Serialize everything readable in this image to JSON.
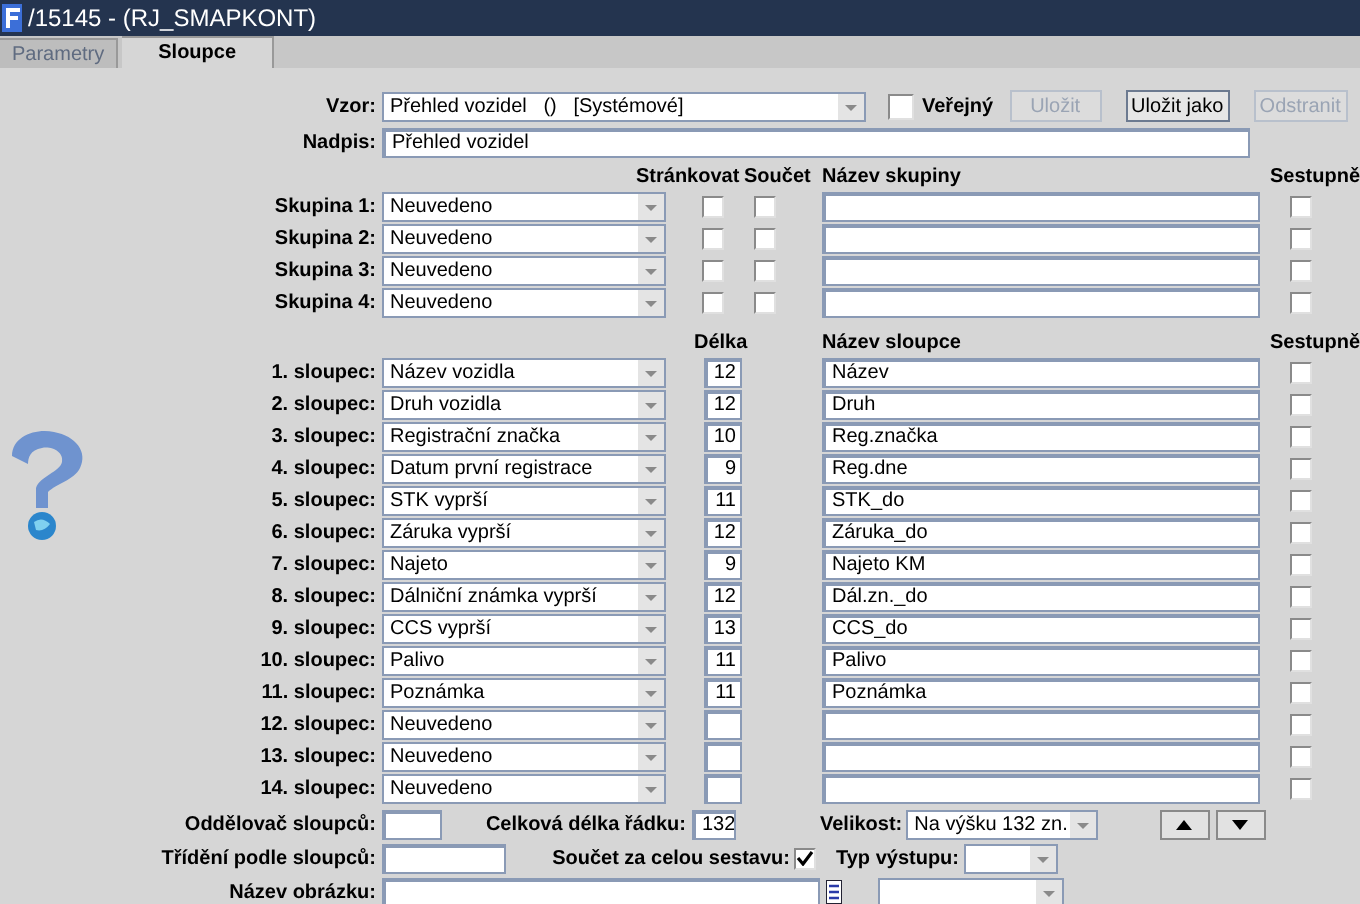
{
  "window": {
    "title": "/15145 - (RJ_SMAPKONT)"
  },
  "tabs": [
    {
      "label": "Parametry",
      "selected": false,
      "disabled": true
    },
    {
      "label": "Sloupce",
      "selected": true,
      "disabled": false
    }
  ],
  "template": {
    "label": "Vzor:",
    "value": "Přehled vozidel   ()   [Systémové]",
    "public": {
      "label": "Veřejný",
      "checked": false
    }
  },
  "buttons": [
    {
      "label": "Uložit",
      "disabled": true
    },
    {
      "label": "Uložit jako",
      "disabled": false
    },
    {
      "label": "Odstranit",
      "disabled": true
    }
  ],
  "heading": {
    "label": "Nadpis:",
    "value": "Přehled vozidel"
  },
  "groups": {
    "headers": [
      "Stránkovat",
      "Součet",
      "Název skupiny",
      "Sestupně"
    ],
    "rows": [
      {
        "label": "Skupina 1:",
        "value": "Neuvedeno",
        "paging": false,
        "sum": false,
        "descending": false
      },
      {
        "label": "Skupina 2:",
        "value": "Neuvedeno",
        "paging": false,
        "sum": false,
        "descending": false
      },
      {
        "label": "Skupina 3:",
        "value": "Neuvedeno",
        "paging": false,
        "sum": false,
        "descending": false
      },
      {
        "label": "Skupina 4:",
        "value": "Neuvedeno",
        "paging": false,
        "sum": false,
        "descending": false
      }
    ]
  },
  "columns": {
    "headers": [
      "Délka",
      "Název sloupce",
      "Sestupně"
    ],
    "rows": [
      {
        "label": "1. sloupec:",
        "value": "Název vozidla",
        "length": "12",
        "name": "Název",
        "descending": false
      },
      {
        "label": "2. sloupec:",
        "value": "Druh vozidla",
        "length": "12",
        "name": "Druh",
        "descending": false
      },
      {
        "label": "3. sloupec:",
        "value": "Registrační značka",
        "length": "10",
        "name": "Reg.značka",
        "descending": false
      },
      {
        "label": "4. sloupec:",
        "value": "Datum první registrace",
        "length": "9",
        "name": "Reg.dne",
        "descending": false
      },
      {
        "label": "5. sloupec:",
        "value": "STK vyprší",
        "length": "11",
        "name": "STK_do",
        "descending": false
      },
      {
        "label": "6. sloupec:",
        "value": "Záruka vyprší",
        "length": "12",
        "name": "Záruka_do",
        "descending": false
      },
      {
        "label": "7. sloupec:",
        "value": "Najeto",
        "length": "9",
        "name": "Najeto KM",
        "descending": false
      },
      {
        "label": "8. sloupec:",
        "value": "Dálniční známka vyprší",
        "length": "12",
        "name": "Dál.zn._do",
        "descending": false
      },
      {
        "label": "9. sloupec:",
        "value": "CCS vyprší",
        "length": "13",
        "name": "CCS_do",
        "descending": false
      },
      {
        "label": "10. sloupec:",
        "value": "Palivo",
        "length": "11",
        "name": "Palivo",
        "descending": false
      },
      {
        "label": "11. sloupec:",
        "value": "Poznámka",
        "length": "11",
        "name": "Poznámka",
        "descending": false
      },
      {
        "label": "12. sloupec:",
        "value": "Neuvedeno",
        "descending": false
      },
      {
        "label": "13. sloupec:",
        "value": "Neuvedeno",
        "descending": false
      },
      {
        "label": "14. sloupec:",
        "value": "Neuvedeno",
        "descending": false
      }
    ]
  },
  "footer": {
    "separator": {
      "label": "Oddělovač sloupců:"
    },
    "total_length": {
      "label": "Celková délka řádku:",
      "value": "132"
    },
    "size": {
      "label": "Velikost:",
      "value": "Na výšku 132 zn."
    },
    "sort": {
      "label": "Třídění podle sloupců:"
    },
    "grand_total": {
      "label": "Součet za celou sestavu:",
      "checked": true
    },
    "output_type": {
      "label": "Typ výstupu:"
    },
    "image_name": {
      "label": "Název obrázku:"
    }
  }
}
